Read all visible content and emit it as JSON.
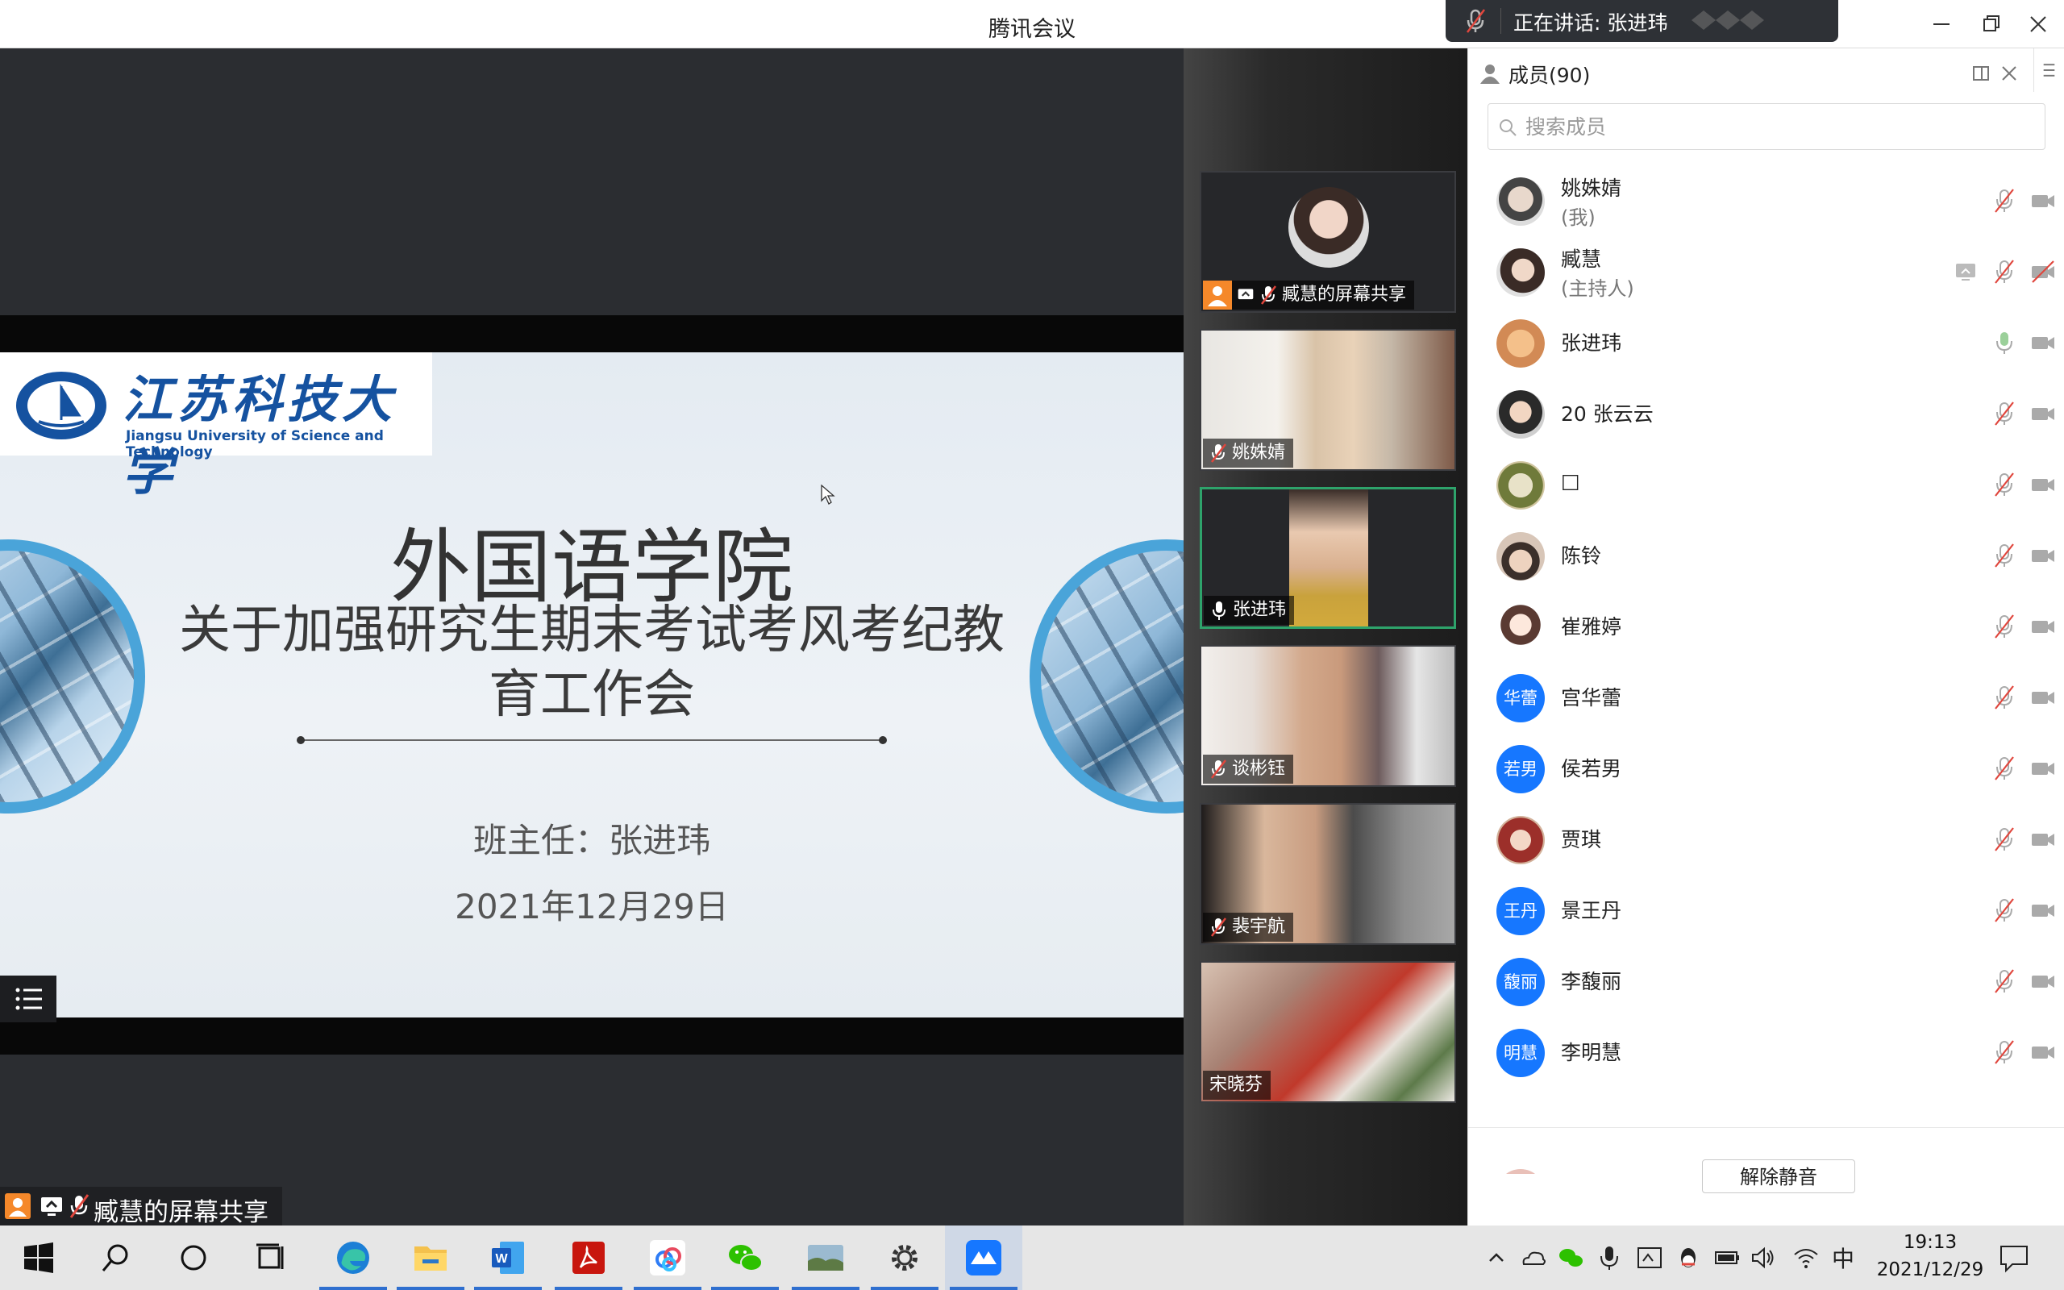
{
  "window": {
    "title": "腾讯会议",
    "speaking_banner": "正在讲话: 张进玮"
  },
  "slide": {
    "logo_cn": "江苏科技大学",
    "logo_en": "Jiangsu University of Science and Technology",
    "title": "外国语学院",
    "subtitle": "关于加强研究生期末考试考风考纪教育工作会",
    "teacher": "班主任：张进玮",
    "date": "2021年12月29日"
  },
  "share_label": "臧慧的屏幕共享",
  "video_tiles": [
    {
      "name": "臧慧的屏幕共享",
      "mic": "muted",
      "active": false
    },
    {
      "name": "姚姝婧",
      "mic": "muted",
      "active": false
    },
    {
      "name": "张进玮",
      "mic": "on",
      "active": true
    },
    {
      "name": "谈彬钰",
      "mic": "muted",
      "active": false
    },
    {
      "name": "裴宇航",
      "mic": "muted",
      "active": false
    },
    {
      "name": "宋晓芬",
      "mic": "none",
      "active": false
    }
  ],
  "members_panel": {
    "title": "成员(90)",
    "search_placeholder": "搜索成员",
    "unmute_all": "解除静音",
    "members": [
      {
        "name": "姚姝婧",
        "role": "(我)",
        "avatar": "photo",
        "mic": "muted",
        "video": "on"
      },
      {
        "name": "臧慧",
        "role": "(主持人)",
        "avatar": "photo",
        "mic": "muted",
        "video": "off",
        "sharing": true
      },
      {
        "name": "张进玮",
        "role": "",
        "avatar": "photo",
        "mic": "on",
        "video": "on"
      },
      {
        "name": "20 张云云",
        "role": "",
        "avatar": "photo",
        "mic": "muted",
        "video": "on"
      },
      {
        "name": "□",
        "role": "",
        "avatar": "photo",
        "mic": "muted",
        "video": "on"
      },
      {
        "name": "陈铃",
        "role": "",
        "avatar": "photo",
        "mic": "muted",
        "video": "on"
      },
      {
        "name": "崔雅婷",
        "role": "",
        "avatar": "photo",
        "mic": "muted",
        "video": "on"
      },
      {
        "name": "宫华蕾",
        "role": "",
        "avatar_text": "华蕾",
        "mic": "muted",
        "video": "on"
      },
      {
        "name": "侯若男",
        "role": "",
        "avatar_text": "若男",
        "mic": "muted",
        "video": "on"
      },
      {
        "name": "贾琪",
        "role": "",
        "avatar": "photo",
        "mic": "muted",
        "video": "on"
      },
      {
        "name": "景王丹",
        "role": "",
        "avatar_text": "王丹",
        "mic": "muted",
        "video": "on"
      },
      {
        "name": "李馥丽",
        "role": "",
        "avatar_text": "馥丽",
        "mic": "muted",
        "video": "on"
      },
      {
        "name": "李明慧",
        "role": "",
        "avatar_text": "明慧",
        "mic": "muted",
        "video": "on"
      }
    ]
  },
  "taskbar": {
    "apps": [
      "windows-start",
      "search",
      "cortana",
      "task-view",
      "edge",
      "file-explorer",
      "word",
      "acrobat",
      "baidu-netdisk",
      "wechat",
      "photos",
      "settings",
      "tencent-meeting"
    ],
    "time": "19:13",
    "date": "2021/12/29",
    "ime": "中"
  },
  "colors": {
    "accent_blue": "#1677ff",
    "active_speaker": "#2ea36b",
    "muted_red": "#e0463d",
    "share_orange": "#f5882a"
  }
}
